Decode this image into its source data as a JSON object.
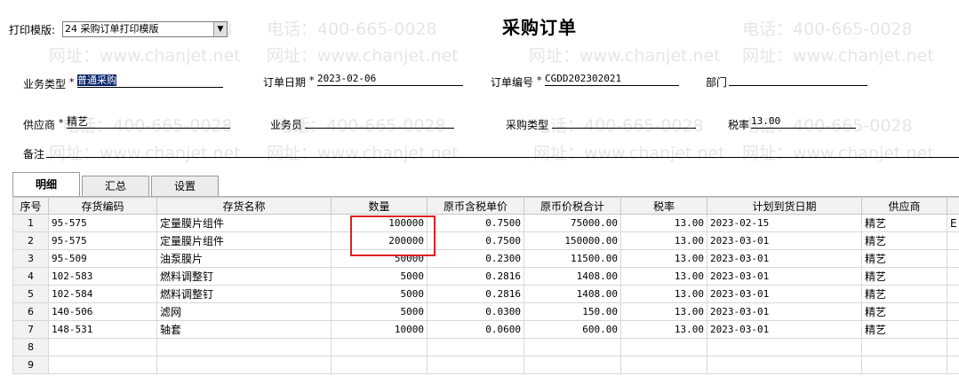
{
  "watermark": {
    "phone": "电话：400-665-0028",
    "site": "网址：www.chanjet.net"
  },
  "title": "采购订单",
  "print_template": {
    "label": "打印模版:",
    "value": "24 采购订单打印模版"
  },
  "fields": {
    "business_type": {
      "label": "业务类型",
      "value": "普通采购"
    },
    "order_date": {
      "label": "订单日期",
      "value": "2023-02-06"
    },
    "order_no": {
      "label": "订单编号",
      "value": "CGDD202302021"
    },
    "department": {
      "label": "部门",
      "value": ""
    },
    "supplier": {
      "label": "供应商",
      "value": "精艺"
    },
    "salesman": {
      "label": "业务员",
      "value": ""
    },
    "purchase_type": {
      "label": "采购类型",
      "value": ""
    },
    "tax_rate": {
      "label": "税率",
      "value": "13.00"
    },
    "remark": {
      "label": "备注",
      "value": ""
    },
    "required_mark": "*"
  },
  "tabs": [
    {
      "label": "明细"
    },
    {
      "label": "汇总"
    },
    {
      "label": "设置"
    }
  ],
  "table": {
    "headers": [
      "序号",
      "存货编码",
      "存货名称",
      "数量",
      "原币含税单价",
      "原币价税合计",
      "税率",
      "计划到货日期",
      "供应商"
    ],
    "rows": [
      [
        "1",
        "95-575",
        "定量膜片组件",
        "100000",
        "0.7500",
        "75000.00",
        "13.00",
        "2023-02-15",
        "精艺"
      ],
      [
        "2",
        "95-575",
        "定量膜片组件",
        "200000",
        "0.7500",
        "150000.00",
        "13.00",
        "2023-03-01",
        "精艺"
      ],
      [
        "3",
        "95-509",
        "油泵膜片",
        "50000",
        "0.2300",
        "11500.00",
        "13.00",
        "2023-03-01",
        "精艺"
      ],
      [
        "4",
        "102-583",
        "燃料调整钉",
        "5000",
        "0.2816",
        "1408.00",
        "13.00",
        "2023-03-01",
        "精艺"
      ],
      [
        "5",
        "102-584",
        "燃料调整钉",
        "5000",
        "0.2816",
        "1408.00",
        "13.00",
        "2023-03-01",
        "精艺"
      ],
      [
        "6",
        "140-506",
        "滤网",
        "5000",
        "0.0300",
        "150.00",
        "13.00",
        "2023-03-01",
        "精艺"
      ],
      [
        "7",
        "148-531",
        "轴套",
        "10000",
        "0.0600",
        "600.00",
        "13.00",
        "2023-03-01",
        "精艺"
      ],
      [
        "8",
        "",
        "",
        "",
        "",
        "",
        "",
        "",
        ""
      ],
      [
        "9",
        "",
        "",
        "",
        "",
        "",
        "",
        "",
        ""
      ]
    ],
    "extra_cell_row1": "E"
  }
}
